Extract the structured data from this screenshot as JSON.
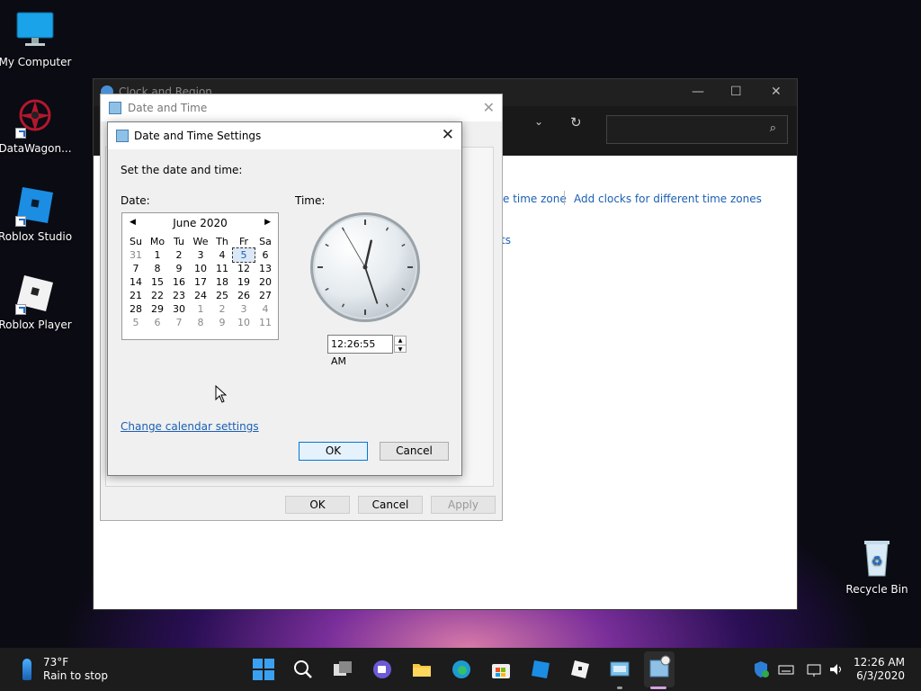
{
  "desktop": {
    "icons": [
      {
        "label": "My Computer",
        "icon": "monitor-icon"
      },
      {
        "label": "DataWagon...",
        "icon": "datawagon-logo-icon"
      },
      {
        "label": "Roblox Studio",
        "icon": "roblox-studio-icon"
      },
      {
        "label": "Roblox Player",
        "icon": "roblox-player-icon"
      },
      {
        "label": "Recycle Bin",
        "icon": "recycle-bin-icon"
      }
    ]
  },
  "back_window": {
    "title": "Clock and Region",
    "link_timezone": "e time zone",
    "link_add_clocks": "Add clocks for different time zones",
    "link_fragment": "ts",
    "btn_fragment": "...",
    "text_fragment": "ne"
  },
  "mid_window": {
    "title": "Date and Time",
    "ok": "OK",
    "cancel": "Cancel",
    "apply": "Apply"
  },
  "dialog": {
    "title": "Date and Time Settings",
    "instruction": "Set the date and time:",
    "date_label": "Date:",
    "time_label": "Time:",
    "month": "June 2020",
    "weekdays": [
      "Su",
      "Mo",
      "Tu",
      "We",
      "Th",
      "Fr",
      "Sa"
    ],
    "days": [
      [
        "31",
        "1",
        "2",
        "3",
        "4",
        "5",
        "6"
      ],
      [
        "7",
        "8",
        "9",
        "10",
        "11",
        "12",
        "13"
      ],
      [
        "14",
        "15",
        "16",
        "17",
        "18",
        "19",
        "20"
      ],
      [
        "21",
        "22",
        "23",
        "24",
        "25",
        "26",
        "27"
      ],
      [
        "28",
        "29",
        "30",
        "1",
        "2",
        "3",
        "4"
      ],
      [
        "5",
        "6",
        "7",
        "8",
        "9",
        "10",
        "11"
      ]
    ],
    "selected_day": "5",
    "time_value": "12:26:55 AM",
    "clock": {
      "hour": 0,
      "minute": 26,
      "second": 55
    },
    "change_calendar": "Change calendar settings",
    "ok": "OK",
    "cancel": "Cancel"
  },
  "taskbar": {
    "weather_temp": "73°F",
    "weather_desc": "Rain to stop",
    "time": "12:26 AM",
    "date": "6/3/2020"
  },
  "colors": {
    "accent": "#0078d7",
    "link": "#1a5fb4"
  }
}
